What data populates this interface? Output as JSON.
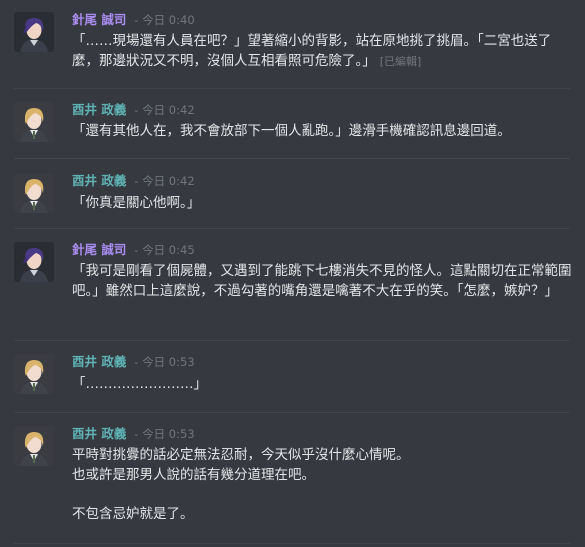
{
  "messages": [
    {
      "author": "針尾 誠司",
      "timestamp": "今日 0:40",
      "lines": [
        "「……現場還有人員在吧？」望著縮小的背影，站在原地挑了挑眉。「二宮也送了麼，那邊狀況又不明，沒個人互相看照可危險了。」"
      ],
      "edited": "[已編輯]"
    },
    {
      "author": "酉井 政義",
      "timestamp": "今日 0:42",
      "lines": [
        "「還有其他人在，我不會放部下一個人亂跑。」邊滑手機確認訊息邊回道。"
      ]
    },
    {
      "author": "酉井 政義",
      "timestamp": "今日 0:42",
      "lines": [
        "「你真是關心他啊。」"
      ]
    },
    {
      "author": "針尾 誠司",
      "timestamp": "今日 0:45",
      "lines": [
        "「我可是剛看了個屍體，又遇到了能跳下七樓消失不見的怪人。這點關切在正常範圍吧。」雖然口上這麼說，不過勾著的嘴角還是噙著不大在乎的笑。「怎麼，嫉妒？」"
      ]
    },
    {
      "author": "酉井 政義",
      "timestamp": "今日 0:53",
      "lines": [
        "「……………………」"
      ]
    },
    {
      "author": "酉井 政義",
      "timestamp": "今日 0:53",
      "lines": [
        "平時對挑釁的話必定無法忍耐，今天似乎沒什麼心情呢。",
        "也或許是那男人說的話有幾分道理在吧。",
        "",
        "不包含忌妒就是了。"
      ]
    }
  ],
  "colors": {
    "background": "#36393f",
    "author_purple": "#a98df0",
    "author_teal": "#5fb3b3",
    "timestamp": "#72767d",
    "text": "#e3e5e8"
  },
  "avatars": [
    "purple-haired-officer-avatar",
    "blonde-officer-avatar"
  ]
}
